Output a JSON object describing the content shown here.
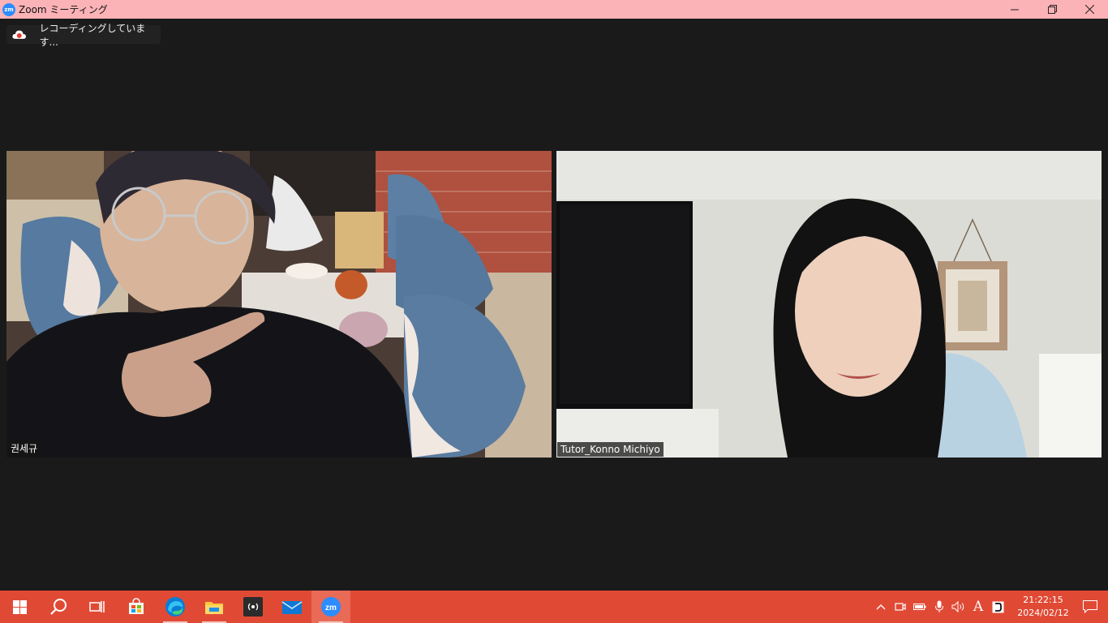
{
  "window": {
    "title": "Zoom ミーティング",
    "logo_text": "zm"
  },
  "recording": {
    "label": "レコーディングしています..."
  },
  "participants": [
    {
      "name": "권세규"
    },
    {
      "name": "Tutor_Konno Michiyo"
    }
  ],
  "taskbar": {
    "pinned": [
      "start-icon",
      "search-icon",
      "task-view-icon",
      "microsoft-store-icon",
      "edge-icon",
      "file-explorer-icon",
      "broadcast-app-icon",
      "mail-icon",
      "zoom-icon"
    ],
    "active": "zoom-icon",
    "zoom_label": "zm"
  },
  "tray": {
    "ime_label": "A",
    "time": "21:22:15",
    "date": "2024/02/12"
  },
  "colors": {
    "titlebar": "#fbb3b7",
    "background": "#1a1a1a",
    "taskbar": "#e04a35",
    "zoom_blue": "#2d8cff"
  }
}
